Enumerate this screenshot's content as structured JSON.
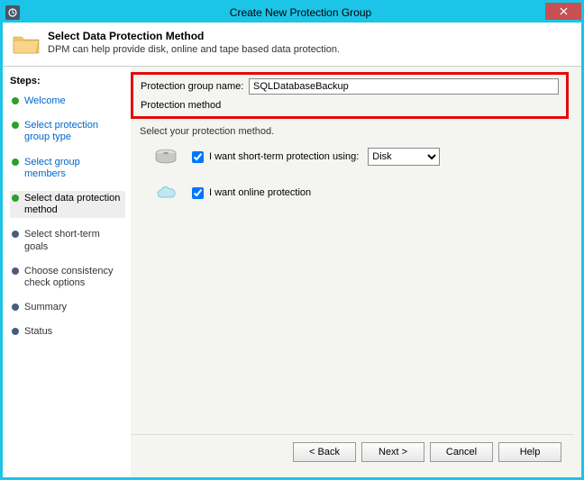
{
  "window": {
    "title": "Create New Protection Group"
  },
  "header": {
    "title": "Select Data Protection Method",
    "subtitle": "DPM can help provide disk, online and tape based data protection."
  },
  "sidebar": {
    "heading": "Steps:",
    "items": [
      {
        "label": "Welcome",
        "state": "completed"
      },
      {
        "label": "Select protection group type",
        "state": "completed"
      },
      {
        "label": "Select group members",
        "state": "completed"
      },
      {
        "label": "Select data protection method",
        "state": "active"
      },
      {
        "label": "Select short-term goals",
        "state": "pending"
      },
      {
        "label": "Choose consistency check options",
        "state": "pending"
      },
      {
        "label": "Summary",
        "state": "pending"
      },
      {
        "label": "Status",
        "state": "pending"
      }
    ]
  },
  "form": {
    "group_name_label": "Protection group name:",
    "group_name_value": "SQLDatabaseBackup",
    "method_label": "Protection method",
    "select_prompt": "Select your protection method.",
    "short_term_label": "I want short-term protection using:",
    "short_term_checked": true,
    "disk_option": "Disk",
    "online_label": "I want online protection",
    "online_checked": true
  },
  "buttons": {
    "back": "< Back",
    "next": "Next >",
    "cancel": "Cancel",
    "help": "Help"
  }
}
